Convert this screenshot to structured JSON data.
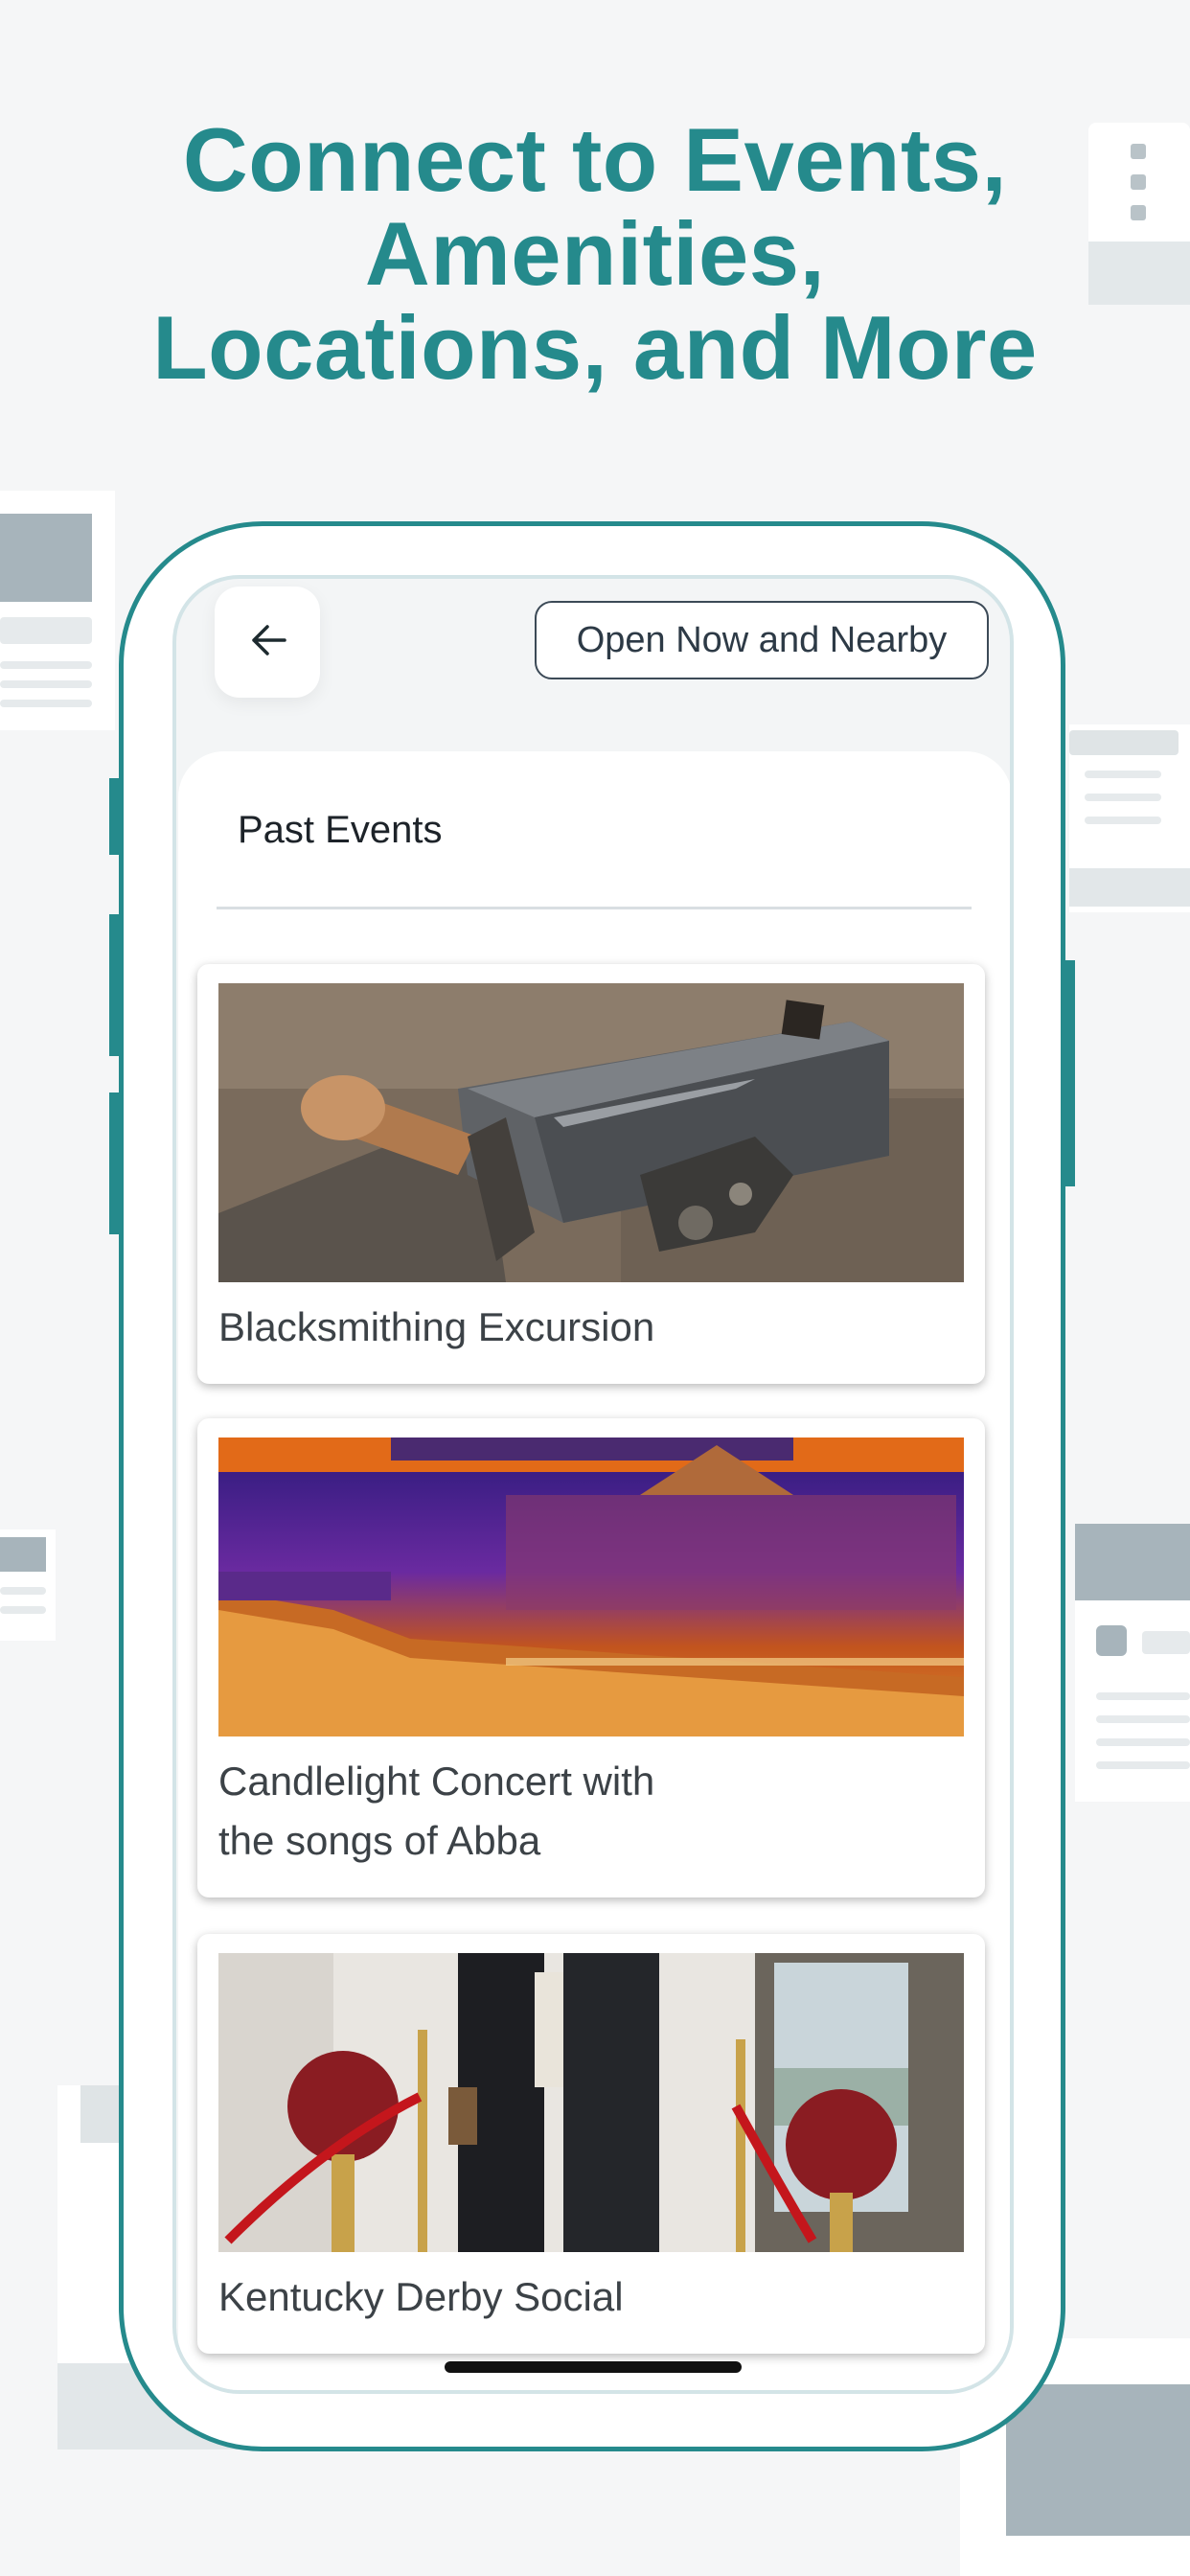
{
  "headline": {
    "line1": "Connect to Events,",
    "line2": "Amenities,",
    "line3": "Locations, and More"
  },
  "colors": {
    "brand_teal": "#258a8c",
    "background": "#f5f6f7",
    "button_border": "#3c4a57"
  },
  "app": {
    "back_icon": "arrow-left-icon",
    "filter_button_label": "Open Now and Nearby",
    "section_title": "Past Events",
    "events": [
      {
        "title": "Blacksmithing Excursion",
        "image": "anvil-hammer-photo"
      },
      {
        "title": "Candlelight Concert with the songs of Abba",
        "image": "candlelit-stage-photo"
      },
      {
        "title": "Kentucky Derby Social",
        "image": "rose-ball-stanchions-photo"
      }
    ]
  }
}
